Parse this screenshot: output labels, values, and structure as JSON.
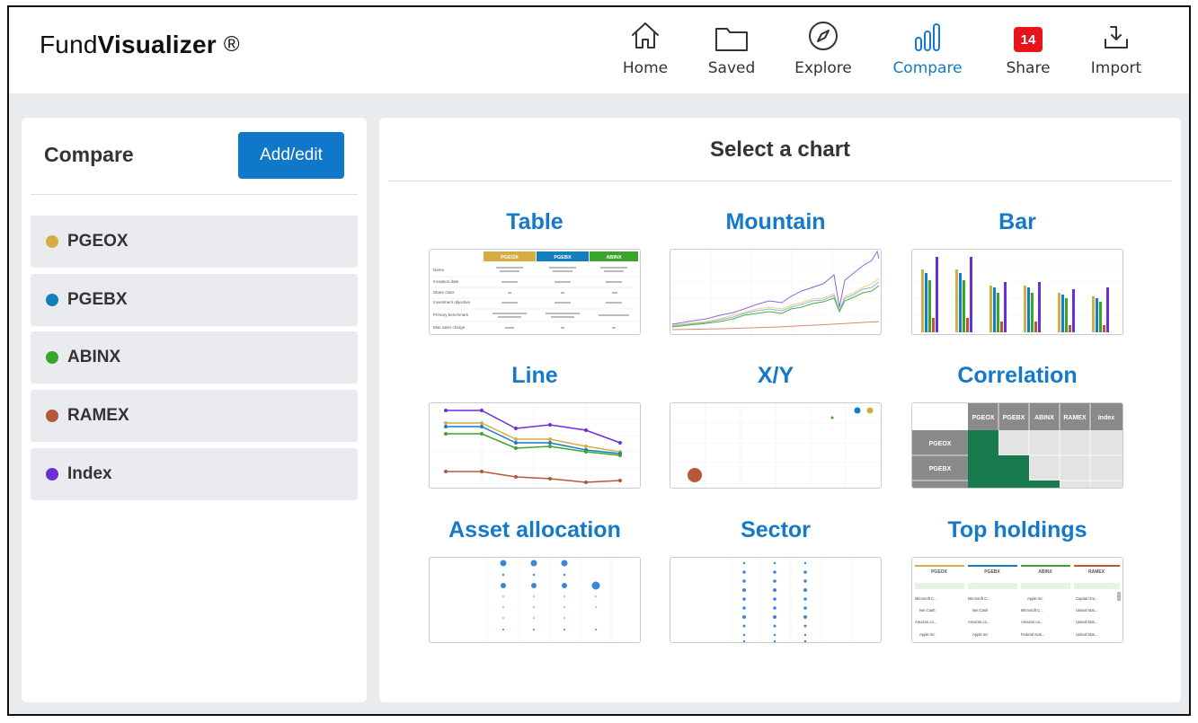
{
  "app": {
    "logo_regular": "Fund",
    "logo_bold": "Visualizer",
    "logo_mark": "®"
  },
  "nav": [
    {
      "label": "Home",
      "icon": "home-icon"
    },
    {
      "label": "Saved",
      "icon": "folder-icon"
    },
    {
      "label": "Explore",
      "icon": "compass-icon"
    },
    {
      "label": "Compare",
      "icon": "bar-chart-icon",
      "active": true
    },
    {
      "label": "Share",
      "icon": "share-badge",
      "badge": "14"
    },
    {
      "label": "Import",
      "icon": "import-icon"
    }
  ],
  "compare": {
    "title": "Compare",
    "add_button": "Add/edit",
    "funds": [
      {
        "name": "PGEOX",
        "color": "#d4ae45"
      },
      {
        "name": "PGEBX",
        "color": "#137fbf"
      },
      {
        "name": "ABINX",
        "color": "#3aa629"
      },
      {
        "name": "RAMEX",
        "color": "#b7583a"
      },
      {
        "name": "Index",
        "color": "#6b2fd6"
      }
    ]
  },
  "charts": {
    "title": "Select a chart",
    "items": [
      {
        "title": "Table"
      },
      {
        "title": "Mountain"
      },
      {
        "title": "Bar"
      },
      {
        "title": "Line"
      },
      {
        "title": "X/Y"
      },
      {
        "title": "Correlation"
      },
      {
        "title": "Asset allocation"
      },
      {
        "title": "Sector"
      },
      {
        "title": "Top holdings"
      }
    ]
  },
  "thumb_table": {
    "headers": [
      "PGEOX",
      "PGEBX",
      "ABINX"
    ],
    "rows": [
      "Name",
      "Inception date",
      "Share class",
      "Investment objective",
      "Primary benchmark",
      "Max sales charge"
    ]
  },
  "thumb_correlation": {
    "cols": [
      "PGEOX",
      "PGEBX",
      "ABINX",
      "RAMEX",
      "Index"
    ],
    "rows": [
      "PGEOX",
      "PGEBX"
    ]
  },
  "thumb_holdings": {
    "funds": [
      "PGEOX",
      "PGEBX",
      "ABINX",
      "RAMEX"
    ],
    "col1": [
      "Microsoft C...",
      "Net Cash",
      "Amazon.co...",
      "Apple Inc"
    ],
    "col2": [
      "Microsoft C...",
      "Net Cash",
      "Amazon.co...",
      "Apple Inc"
    ],
    "col3": [
      "Apple Inc",
      "Microsoft C...",
      "Amazon.co...",
      "Federal Nati..."
    ],
    "col4": [
      "Capital Gro...",
      "United Stat...",
      "United Stat...",
      "United Stat..."
    ]
  }
}
